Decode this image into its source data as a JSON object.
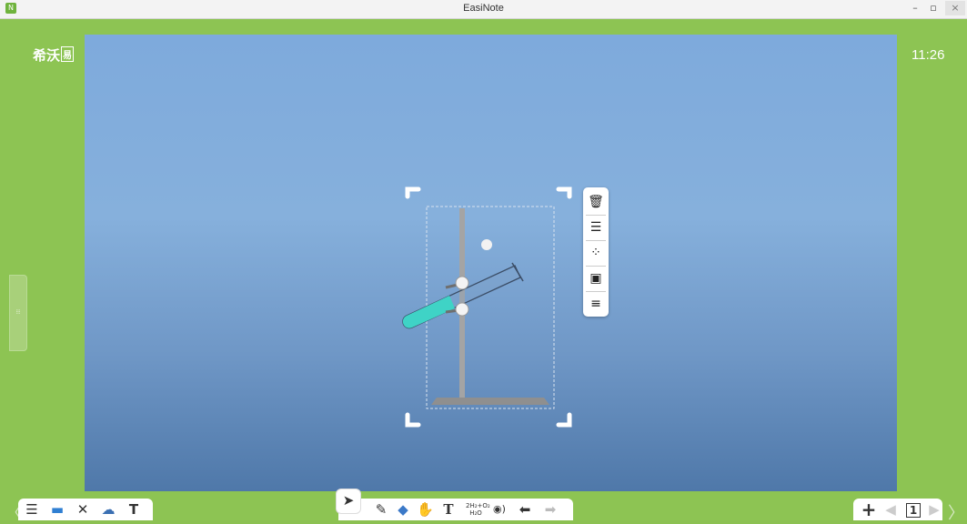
{
  "window": {
    "title": "EasiNote",
    "app_icon": "easinote-app-icon",
    "controls": {
      "minimize": "–",
      "maximize": "▫",
      "close": "×"
    }
  },
  "brand": {
    "name": "希沃",
    "badge": "易"
  },
  "clock": "11:26",
  "side_tab": {
    "label": "⁝⁝"
  },
  "colors": {
    "frame_green": "#8dc453",
    "canvas_top": "#7eaadc",
    "canvas_bottom": "#4f78a9",
    "liquid": "#3fd3c6"
  },
  "toolbar_left": [
    "menu-icon",
    "display-icon",
    "tools-icon",
    "cloud-icon",
    "text-format-icon"
  ],
  "toolbar_mid": [
    "select-pointer-icon",
    "pen-icon",
    "eraser-icon",
    "hand-icon",
    "text-icon",
    "formula-icon",
    "audio-icon",
    "undo-icon",
    "redo-icon"
  ],
  "toolbar_right": {
    "add": "+",
    "page_number": "1"
  },
  "float_menu": [
    "delete-icon",
    "align-icon",
    "effects-icon",
    "layer-icon",
    "more-icon"
  ],
  "formula_label": {
    "top": "2H₂+O₂",
    "bottom": "H₂O"
  }
}
